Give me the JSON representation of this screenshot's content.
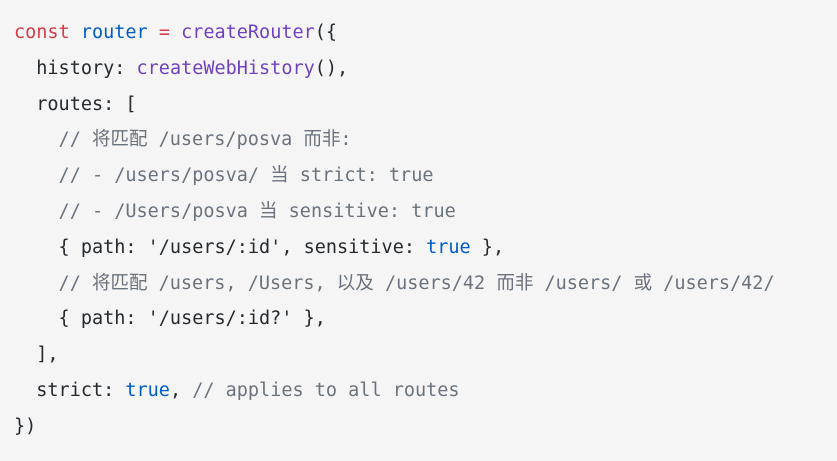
{
  "code": {
    "lines": [
      [
        {
          "t": "const",
          "c": "kw"
        },
        {
          "t": " ",
          "c": "plain"
        },
        {
          "t": "router",
          "c": "var"
        },
        {
          "t": " ",
          "c": "plain"
        },
        {
          "t": "=",
          "c": "kw"
        },
        {
          "t": " ",
          "c": "plain"
        },
        {
          "t": "createRouter",
          "c": "fn"
        },
        {
          "t": "({",
          "c": "plain"
        }
      ],
      [
        {
          "t": "  history: ",
          "c": "plain"
        },
        {
          "t": "createWebHistory",
          "c": "fn"
        },
        {
          "t": "(),",
          "c": "plain"
        }
      ],
      [
        {
          "t": "  routes: [",
          "c": "plain"
        }
      ],
      [
        {
          "t": "    // 将匹配 /users/posva 而非:",
          "c": "cmt"
        }
      ],
      [
        {
          "t": "    // - /users/posva/ 当 strict: true",
          "c": "cmt"
        }
      ],
      [
        {
          "t": "    // - /Users/posva 当 sensitive: true",
          "c": "cmt"
        }
      ],
      [
        {
          "t": "    { path: ",
          "c": "plain"
        },
        {
          "t": "'/users/:id'",
          "c": "str"
        },
        {
          "t": ", sensitive: ",
          "c": "plain"
        },
        {
          "t": "true",
          "c": "bool"
        },
        {
          "t": " },",
          "c": "plain"
        }
      ],
      [
        {
          "t": "    // 将匹配 /users, /Users, 以及 /users/42 而非 /users/ 或 /users/42/",
          "c": "cmt"
        }
      ],
      [
        {
          "t": "    { path: ",
          "c": "plain"
        },
        {
          "t": "'/users/:id?'",
          "c": "str"
        },
        {
          "t": " },",
          "c": "plain"
        }
      ],
      [
        {
          "t": "  ],",
          "c": "plain"
        }
      ],
      [
        {
          "t": "  strict: ",
          "c": "plain"
        },
        {
          "t": "true",
          "c": "bool"
        },
        {
          "t": ", ",
          "c": "plain"
        },
        {
          "t": "// applies to all routes",
          "c": "cmt"
        }
      ],
      [
        {
          "t": "})",
          "c": "plain"
        }
      ]
    ]
  }
}
